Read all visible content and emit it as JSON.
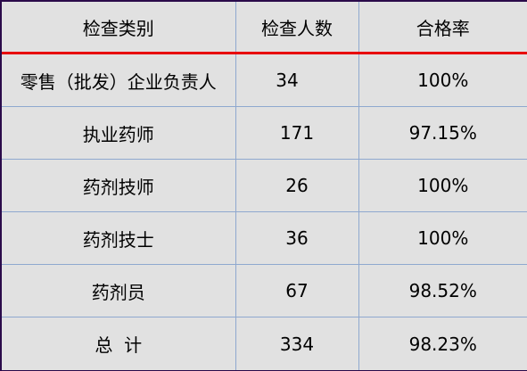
{
  "table": {
    "headers": [
      "检查类别",
      "检查人数",
      "合格率"
    ],
    "rows": [
      [
        "零售（批发）企业负责人",
        "34",
        "100%"
      ],
      [
        "执业药师",
        "171",
        "97.15%"
      ],
      [
        "药剂技师",
        "26",
        "100%"
      ],
      [
        "药剂技士",
        "36",
        "100%"
      ],
      [
        "药剂员",
        "67",
        "98.52%"
      ],
      [
        "总  计",
        "334",
        "98.23%"
      ]
    ]
  }
}
